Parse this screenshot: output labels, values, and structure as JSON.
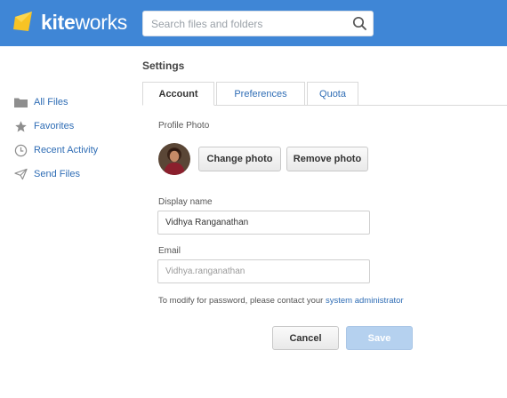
{
  "header": {
    "logo_bold": "kite",
    "logo_light": "works",
    "search_placeholder": "Search files and folders"
  },
  "sidebar": {
    "items": [
      {
        "label": "All Files",
        "icon": "folder-icon"
      },
      {
        "label": "Favorites",
        "icon": "star-icon"
      },
      {
        "label": "Recent Activity",
        "icon": "clock-icon"
      },
      {
        "label": "Send Files",
        "icon": "paper-plane-icon"
      }
    ]
  },
  "settings": {
    "title": "Settings",
    "tabs": [
      {
        "label": "Account",
        "active": true
      },
      {
        "label": "Preferences",
        "active": false
      },
      {
        "label": "Quota",
        "active": false
      }
    ],
    "profile_photo_label": "Profile Photo",
    "change_photo": "Change photo",
    "remove_photo": "Remove photo",
    "display_name_label": "Display name",
    "display_name_value": "Vidhya Ranganathan",
    "email_label": "Email",
    "email_value": "Vidhya.ranganathan",
    "note_text": "To modify for password, please contact your ",
    "note_link": "system administrator",
    "cancel": "Cancel",
    "save": "Save"
  },
  "colors": {
    "header_bg": "#3f86d6",
    "link": "#2f6db5",
    "logo_yellow": "#f7c325",
    "save_disabled": "#b5d1ef"
  }
}
